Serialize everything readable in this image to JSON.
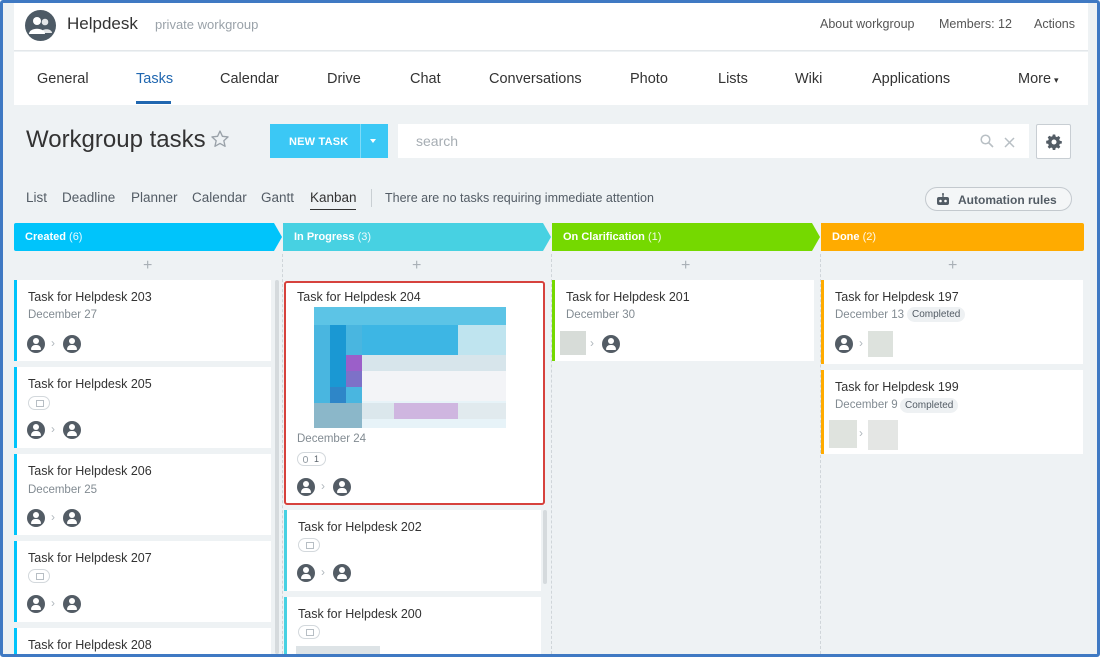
{
  "header": {
    "app_title": "Helpdesk",
    "app_subtitle": "private workgroup",
    "about": "About workgroup",
    "members": "Members: 12",
    "actions": "Actions"
  },
  "tabs": [
    "General",
    "Tasks",
    "Calendar",
    "Drive",
    "Chat",
    "Conversations",
    "Photo",
    "Lists",
    "Wiki",
    "Applications",
    "More"
  ],
  "toolbar": {
    "title": "Workgroup tasks",
    "new_task": "NEW TASK",
    "search_placeholder": "search"
  },
  "views": [
    "List",
    "Deadline",
    "Planner",
    "Calendar",
    "Gantt",
    "Kanban"
  ],
  "notice": "There are no tasks requiring immediate attention",
  "automation": "Automation rules",
  "columns": [
    {
      "name": "Created",
      "count": "(6)",
      "color": "#00c4fb"
    },
    {
      "name": "In Progress",
      "count": "(3)",
      "color": "#47d1e2"
    },
    {
      "name": "On Clarification",
      "count": "(1)",
      "color": "#75d900"
    },
    {
      "name": "Done",
      "count": "(2)",
      "color": "#ffab00"
    }
  ],
  "cards": {
    "c203": {
      "name": "Task for Helpdesk 203",
      "date": "December 27"
    },
    "c205": {
      "name": "Task for Helpdesk 205"
    },
    "c206": {
      "name": "Task for Helpdesk 206",
      "date": "December 25"
    },
    "c207": {
      "name": "Task for Helpdesk 207"
    },
    "c208": {
      "name": "Task for Helpdesk 208"
    },
    "c204": {
      "name": "Task for Helpdesk 204",
      "date": "December 24",
      "attachments": "1"
    },
    "c202": {
      "name": "Task for Helpdesk 202"
    },
    "c200": {
      "name": "Task for Helpdesk 200"
    },
    "c201": {
      "name": "Task for Helpdesk 201",
      "date": "December 30"
    },
    "c197": {
      "name": "Task for Helpdesk 197",
      "date": "December 13",
      "status": "Completed"
    },
    "c199": {
      "name": "Task for Helpdesk 199",
      "date": "December 9",
      "status": "Completed"
    }
  }
}
